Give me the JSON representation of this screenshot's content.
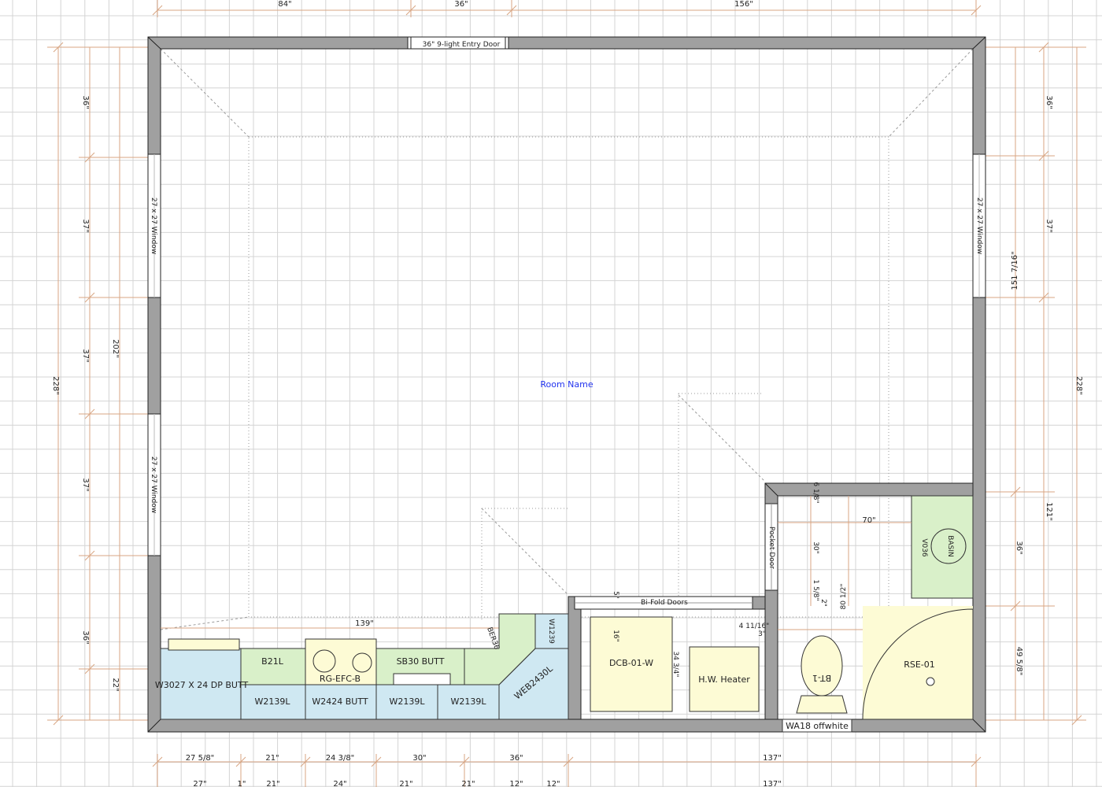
{
  "room_name": "Room Name",
  "colors": {
    "grid": "#d4d4d4",
    "wall": "#a0a0a0",
    "dimension_line": "#d8a583",
    "upper_cabinet": "#cfe8f2",
    "base_cabinet": "#d9f0c9",
    "appliance": "#fdfbd5",
    "room_label": "#2233ee"
  },
  "top_dimensions": [
    "84\"",
    "36\"",
    "156\""
  ],
  "bottom_dimensions_row1": [
    "27 5/8\"",
    "21\"",
    "24 3/8\"",
    "30\"",
    "36\"",
    "137\""
  ],
  "bottom_dimensions_row2": [
    "27\"",
    "1\"",
    "21\"",
    "24\"",
    "21\"",
    "21\"",
    "12\"",
    "12\"",
    "137\""
  ],
  "left_dimensions": [
    "36\"",
    "37\"",
    "37\"",
    "37\"",
    "36\"",
    "22\""
  ],
  "left_total_inner": "202\"",
  "left_total_outer": "228\"",
  "right_dimensions": [
    "36\"",
    "37\"",
    "121\"",
    "36\"",
    "49 5/8\""
  ],
  "right_total_inner": "151 7/16\"",
  "right_total_outer": "228\"",
  "doors": {
    "entry": "36\" 9-light Entry Door",
    "bifold": "Bi-Fold Doors",
    "pocket": "Pocket Door"
  },
  "windows": {
    "left_upper": "27 x 27 Window",
    "left_lower": "27 x 27 Window",
    "right": "27 x 27 Window"
  },
  "upper_cabinets": [
    "W3027 X 24 DP BUTT",
    "W2139L",
    "W2424 BUTT",
    "W2139L",
    "W2139L",
    "WEB2430L",
    "W1239"
  ],
  "base_cabinets": [
    "B21L",
    "RG-EFC-B",
    "SB30 BUTT",
    "BER36"
  ],
  "utility": {
    "cabinet": "DCB-01-W",
    "heater": "H.W. Heater",
    "vanity": "V036",
    "toilet": "BT-1",
    "shower": "RSE-01",
    "wall_cabinet": "WA18  offwhite",
    "basin": "BASIN"
  },
  "misc_dimensions": {
    "counter_run": "139\"",
    "bath_width": "70\"",
    "d_61": "6 1/8\"",
    "d_30": "30\"",
    "d_158": "1 5/8\"",
    "d_2": "2\"",
    "d_805": "80 1/2\"",
    "d_411": "4 11/16\"",
    "d_3": "3\"",
    "d_34": "34 3/4\"",
    "d_5": "5\"",
    "d_16": "16\""
  }
}
